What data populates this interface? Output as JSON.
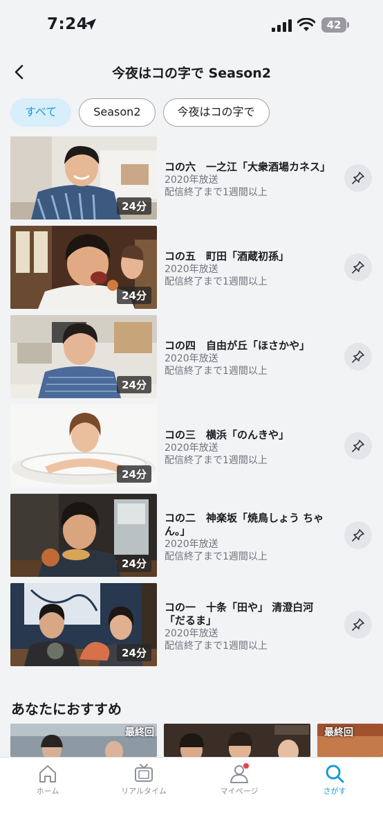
{
  "status_bar": {
    "time": "7:24",
    "battery": "42"
  },
  "header": {
    "title": "今夜はコの字で Season2"
  },
  "chips": [
    {
      "label": "すべて",
      "active": true
    },
    {
      "label": "Season2",
      "active": false
    },
    {
      "label": "今夜はコの字で",
      "active": false
    }
  ],
  "episodes": [
    {
      "title": "コの六　一之江「大衆酒場カネス」",
      "year": "2020年放送",
      "availability": "配信終了まで1週間以上",
      "duration": "24分"
    },
    {
      "title": "コの五　町田「酒蔵初孫」",
      "year": "2020年放送",
      "availability": "配信終了まで1週間以上",
      "duration": "24分"
    },
    {
      "title": "コの四　自由が丘「ほさかや」",
      "year": "2020年放送",
      "availability": "配信終了まで1週間以上",
      "duration": "24分"
    },
    {
      "title": "コの三　横浜「のんきや」",
      "year": "2020年放送",
      "availability": "配信終了まで1週間以上",
      "duration": "24分"
    },
    {
      "title": "コの二　神楽坂「焼鳥しょう ちゃん。」",
      "year": "2020年放送",
      "availability": "配信終了まで1週間以上",
      "duration": "24分"
    },
    {
      "title": "コの一　十条「田や」 清澄白河 「だるま」",
      "year": "2020年放送",
      "availability": "配信終了まで1週間以上",
      "duration": "24分"
    }
  ],
  "recommendations": {
    "title": "あなたにおすすめ",
    "badges": [
      "最終回",
      "",
      "最終回"
    ]
  },
  "tabs": [
    {
      "label": "ホーム",
      "icon": "home-icon",
      "active": false
    },
    {
      "label": "リアルタイム",
      "icon": "tv-icon",
      "active": false
    },
    {
      "label": "マイページ",
      "icon": "user-icon",
      "active": false
    },
    {
      "label": "さがす",
      "icon": "search-icon",
      "active": true
    }
  ],
  "colors": {
    "accent": "#1a9ad6",
    "chip_active_bg": "#d8eefa",
    "notification": "#e8414c"
  }
}
